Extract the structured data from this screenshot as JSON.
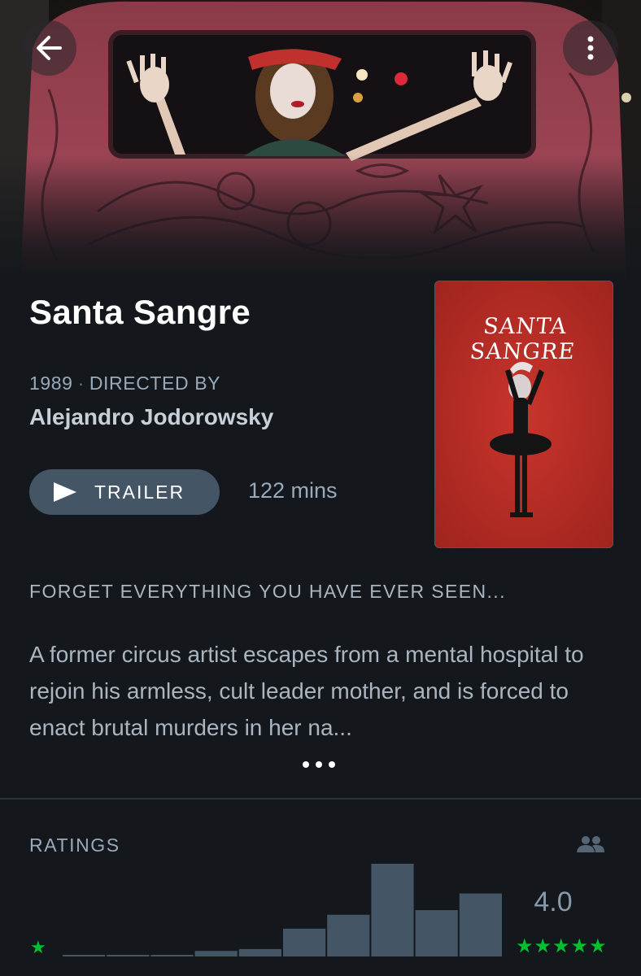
{
  "nav": {
    "back_icon": "arrow-left-icon",
    "menu_icon": "more-vertical-icon"
  },
  "film": {
    "title": "Santa Sangre",
    "year": "1989",
    "separator": "·",
    "directed_by_label": "DIRECTED BY",
    "director": "Alejandro Jodorowsky",
    "trailer_label": "TRAILER",
    "runtime": "122 mins",
    "poster_title": "SANTA SANGRE",
    "tagline": "FORGET EVERYTHING YOU HAVE EVER SEEN...",
    "synopsis": "A former circus artist escapes from a mental hospital to rejoin his armless, cult leader mother, and is forced to enact brutal murders in her na..."
  },
  "ratings": {
    "label": "RATINGS",
    "average": "4.0",
    "min_star": "★",
    "max_stars": "★★★★★",
    "people_icon": "people-icon",
    "distribution": [
      0.01,
      0.01,
      0.01,
      0.06,
      0.08,
      0.3,
      0.45,
      1.0,
      0.5,
      0.68
    ]
  },
  "colors": {
    "background": "#14181c",
    "accent_green": "#00c030",
    "bar": "#445566",
    "button": "#445566"
  }
}
